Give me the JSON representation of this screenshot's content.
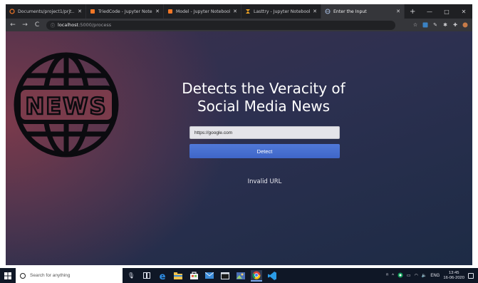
{
  "browser": {
    "tabs": [
      {
        "title": "Documents/project1/prjt...",
        "icon": "jupyter-icon",
        "active": false
      },
      {
        "title": "TriedCode - Jupyter Noteb...",
        "icon": "notebook-icon",
        "active": false
      },
      {
        "title": "Model - Jupyter Notebook",
        "icon": "notebook-icon",
        "active": false
      },
      {
        "title": "Lasttry - Jupyter Notebook",
        "icon": "hourglass-icon",
        "active": false
      },
      {
        "title": "Enter the Input",
        "icon": "globe-icon",
        "active": true
      }
    ],
    "new_tab": "+",
    "window_controls": [
      "—",
      "□",
      "✕"
    ],
    "url_host": "localhost",
    "url_path": ":5000/process"
  },
  "page": {
    "logo_text": "NEWS",
    "heading_line1": "Detects the Veracity of",
    "heading_line2": "Social Media News",
    "input_value": "https://google.com",
    "detect_label": "Detect",
    "result_text": "Invalid URL"
  },
  "taskbar": {
    "search_placeholder": "Search for anything",
    "language": "ENG",
    "time": "13:45",
    "date": "16-06-2020"
  },
  "colors": {
    "button": "#4a72d4",
    "tab_active": "#35363a",
    "taskbar": "#0f1726"
  }
}
